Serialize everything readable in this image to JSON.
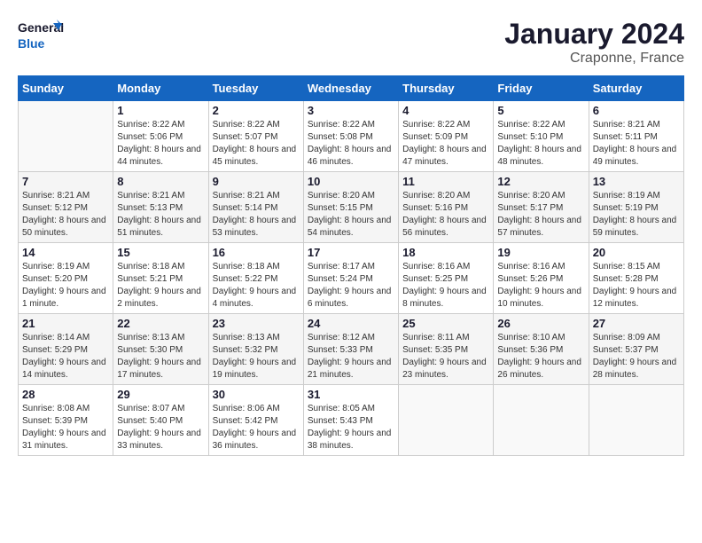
{
  "logo": {
    "general": "General",
    "blue": "Blue"
  },
  "title": "January 2024",
  "subtitle": "Craponne, France",
  "days_header": [
    "Sunday",
    "Monday",
    "Tuesday",
    "Wednesday",
    "Thursday",
    "Friday",
    "Saturday"
  ],
  "weeks": [
    [
      {
        "num": "",
        "sunrise": "",
        "sunset": "",
        "daylight": ""
      },
      {
        "num": "1",
        "sunrise": "Sunrise: 8:22 AM",
        "sunset": "Sunset: 5:06 PM",
        "daylight": "Daylight: 8 hours and 44 minutes."
      },
      {
        "num": "2",
        "sunrise": "Sunrise: 8:22 AM",
        "sunset": "Sunset: 5:07 PM",
        "daylight": "Daylight: 8 hours and 45 minutes."
      },
      {
        "num": "3",
        "sunrise": "Sunrise: 8:22 AM",
        "sunset": "Sunset: 5:08 PM",
        "daylight": "Daylight: 8 hours and 46 minutes."
      },
      {
        "num": "4",
        "sunrise": "Sunrise: 8:22 AM",
        "sunset": "Sunset: 5:09 PM",
        "daylight": "Daylight: 8 hours and 47 minutes."
      },
      {
        "num": "5",
        "sunrise": "Sunrise: 8:22 AM",
        "sunset": "Sunset: 5:10 PM",
        "daylight": "Daylight: 8 hours and 48 minutes."
      },
      {
        "num": "6",
        "sunrise": "Sunrise: 8:21 AM",
        "sunset": "Sunset: 5:11 PM",
        "daylight": "Daylight: 8 hours and 49 minutes."
      }
    ],
    [
      {
        "num": "7",
        "sunrise": "Sunrise: 8:21 AM",
        "sunset": "Sunset: 5:12 PM",
        "daylight": "Daylight: 8 hours and 50 minutes."
      },
      {
        "num": "8",
        "sunrise": "Sunrise: 8:21 AM",
        "sunset": "Sunset: 5:13 PM",
        "daylight": "Daylight: 8 hours and 51 minutes."
      },
      {
        "num": "9",
        "sunrise": "Sunrise: 8:21 AM",
        "sunset": "Sunset: 5:14 PM",
        "daylight": "Daylight: 8 hours and 53 minutes."
      },
      {
        "num": "10",
        "sunrise": "Sunrise: 8:20 AM",
        "sunset": "Sunset: 5:15 PM",
        "daylight": "Daylight: 8 hours and 54 minutes."
      },
      {
        "num": "11",
        "sunrise": "Sunrise: 8:20 AM",
        "sunset": "Sunset: 5:16 PM",
        "daylight": "Daylight: 8 hours and 56 minutes."
      },
      {
        "num": "12",
        "sunrise": "Sunrise: 8:20 AM",
        "sunset": "Sunset: 5:17 PM",
        "daylight": "Daylight: 8 hours and 57 minutes."
      },
      {
        "num": "13",
        "sunrise": "Sunrise: 8:19 AM",
        "sunset": "Sunset: 5:19 PM",
        "daylight": "Daylight: 8 hours and 59 minutes."
      }
    ],
    [
      {
        "num": "14",
        "sunrise": "Sunrise: 8:19 AM",
        "sunset": "Sunset: 5:20 PM",
        "daylight": "Daylight: 9 hours and 1 minute."
      },
      {
        "num": "15",
        "sunrise": "Sunrise: 8:18 AM",
        "sunset": "Sunset: 5:21 PM",
        "daylight": "Daylight: 9 hours and 2 minutes."
      },
      {
        "num": "16",
        "sunrise": "Sunrise: 8:18 AM",
        "sunset": "Sunset: 5:22 PM",
        "daylight": "Daylight: 9 hours and 4 minutes."
      },
      {
        "num": "17",
        "sunrise": "Sunrise: 8:17 AM",
        "sunset": "Sunset: 5:24 PM",
        "daylight": "Daylight: 9 hours and 6 minutes."
      },
      {
        "num": "18",
        "sunrise": "Sunrise: 8:16 AM",
        "sunset": "Sunset: 5:25 PM",
        "daylight": "Daylight: 9 hours and 8 minutes."
      },
      {
        "num": "19",
        "sunrise": "Sunrise: 8:16 AM",
        "sunset": "Sunset: 5:26 PM",
        "daylight": "Daylight: 9 hours and 10 minutes."
      },
      {
        "num": "20",
        "sunrise": "Sunrise: 8:15 AM",
        "sunset": "Sunset: 5:28 PM",
        "daylight": "Daylight: 9 hours and 12 minutes."
      }
    ],
    [
      {
        "num": "21",
        "sunrise": "Sunrise: 8:14 AM",
        "sunset": "Sunset: 5:29 PM",
        "daylight": "Daylight: 9 hours and 14 minutes."
      },
      {
        "num": "22",
        "sunrise": "Sunrise: 8:13 AM",
        "sunset": "Sunset: 5:30 PM",
        "daylight": "Daylight: 9 hours and 17 minutes."
      },
      {
        "num": "23",
        "sunrise": "Sunrise: 8:13 AM",
        "sunset": "Sunset: 5:32 PM",
        "daylight": "Daylight: 9 hours and 19 minutes."
      },
      {
        "num": "24",
        "sunrise": "Sunrise: 8:12 AM",
        "sunset": "Sunset: 5:33 PM",
        "daylight": "Daylight: 9 hours and 21 minutes."
      },
      {
        "num": "25",
        "sunrise": "Sunrise: 8:11 AM",
        "sunset": "Sunset: 5:35 PM",
        "daylight": "Daylight: 9 hours and 23 minutes."
      },
      {
        "num": "26",
        "sunrise": "Sunrise: 8:10 AM",
        "sunset": "Sunset: 5:36 PM",
        "daylight": "Daylight: 9 hours and 26 minutes."
      },
      {
        "num": "27",
        "sunrise": "Sunrise: 8:09 AM",
        "sunset": "Sunset: 5:37 PM",
        "daylight": "Daylight: 9 hours and 28 minutes."
      }
    ],
    [
      {
        "num": "28",
        "sunrise": "Sunrise: 8:08 AM",
        "sunset": "Sunset: 5:39 PM",
        "daylight": "Daylight: 9 hours and 31 minutes."
      },
      {
        "num": "29",
        "sunrise": "Sunrise: 8:07 AM",
        "sunset": "Sunset: 5:40 PM",
        "daylight": "Daylight: 9 hours and 33 minutes."
      },
      {
        "num": "30",
        "sunrise": "Sunrise: 8:06 AM",
        "sunset": "Sunset: 5:42 PM",
        "daylight": "Daylight: 9 hours and 36 minutes."
      },
      {
        "num": "31",
        "sunrise": "Sunrise: 8:05 AM",
        "sunset": "Sunset: 5:43 PM",
        "daylight": "Daylight: 9 hours and 38 minutes."
      },
      {
        "num": "",
        "sunrise": "",
        "sunset": "",
        "daylight": ""
      },
      {
        "num": "",
        "sunrise": "",
        "sunset": "",
        "daylight": ""
      },
      {
        "num": "",
        "sunrise": "",
        "sunset": "",
        "daylight": ""
      }
    ]
  ]
}
